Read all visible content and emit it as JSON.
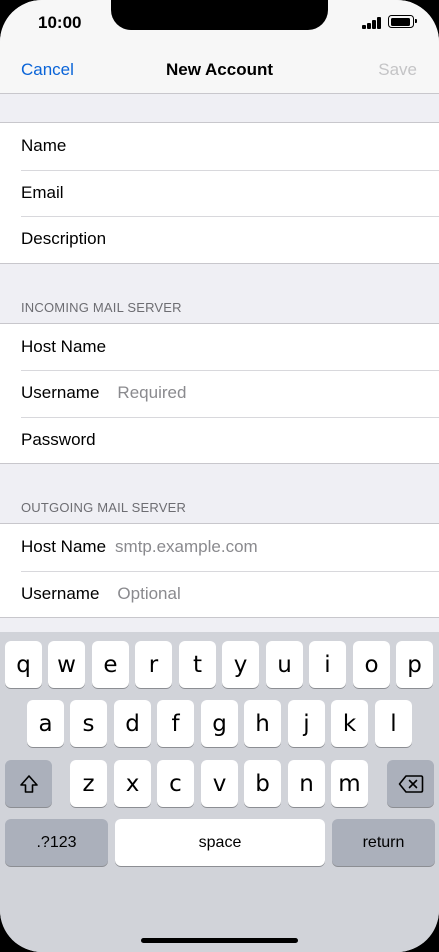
{
  "status_bar": {
    "time": "10:00"
  },
  "nav": {
    "cancel": "Cancel",
    "title": "New Account",
    "save": "Save"
  },
  "account_fields": [
    {
      "label": "Name"
    },
    {
      "label": "Email"
    },
    {
      "label": "Description"
    }
  ],
  "incoming": {
    "header": "INCOMING MAIL SERVER",
    "host_name": "Host Name",
    "username": "Username",
    "username_placeholder": "Required",
    "password": "Password"
  },
  "outgoing": {
    "header": "OUTGOING MAIL SERVER",
    "host_name": "Host Name",
    "host_value": "smtp.example.com",
    "username": "Username",
    "username_placeholder": "Optional"
  },
  "keyboard": {
    "row1": [
      "q",
      "w",
      "e",
      "r",
      "t",
      "y",
      "u",
      "i",
      "o",
      "p"
    ],
    "row2": [
      "a",
      "s",
      "d",
      "f",
      "g",
      "h",
      "j",
      "k",
      "l"
    ],
    "row3": [
      "z",
      "x",
      "c",
      "v",
      "b",
      "n",
      "m"
    ],
    "numbers": ".?123",
    "space": "space",
    "return": "return",
    "shift_icon": "shift-icon",
    "delete_icon": "delete-icon"
  }
}
